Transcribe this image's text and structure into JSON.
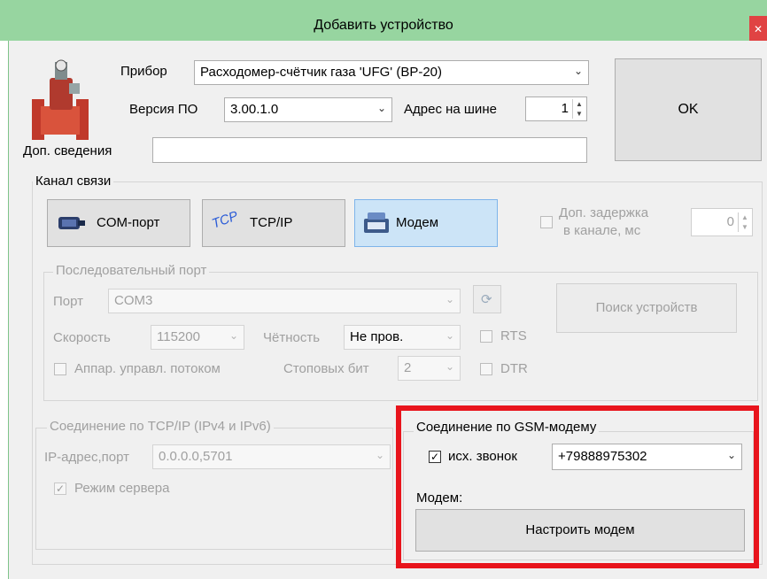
{
  "window": {
    "title": "Добавить устройство",
    "close_icon": "✕"
  },
  "device_row": {
    "label": "Прибор",
    "value": "Расходомер-счётчик газа 'UFG' (BP-20)"
  },
  "firmware_row": {
    "label": "Версия ПО",
    "value": "3.00.1.0",
    "bus_label": "Адрес на шине",
    "bus_value": "1"
  },
  "ok_button": "OK",
  "extra_info": {
    "label": "Доп. сведения",
    "value": ""
  },
  "channel": {
    "label": "Канал связи",
    "buttons": [
      {
        "label": "COM-порт",
        "icon": "serial-port-icon"
      },
      {
        "label": "TCP/IP",
        "icon": "tcp-icon",
        "icon_text": "TCP"
      },
      {
        "label": "Модем",
        "icon": "modem-icon"
      }
    ],
    "active": "Модем",
    "delay_label_1": "Доп. задержка",
    "delay_label_2": "в канале, мс",
    "delay_value": "0"
  },
  "serial": {
    "label": "Последовательный порт",
    "port_label": "Порт",
    "port_value": "COM3",
    "speed_label": "Скорость",
    "speed_value": "115200",
    "parity_label": "Чётность",
    "parity_value": "Не пров.",
    "rts_label": "RTS",
    "dtr_label": "DTR",
    "flow_label": "Аппар. управл. потоком",
    "stop_label": "Стоповых бит",
    "stop_value": "2",
    "search_button": "Поиск устройств"
  },
  "tcp": {
    "label": "Соединение по TCP/IP (IPv4 и IPv6)",
    "ip_label": "IP-адрес,порт",
    "ip_value": "0.0.0.0,5701",
    "server_label": "Режим сервера"
  },
  "gsm": {
    "label": "Соединение по GSM-модему",
    "call_label": "исх. звонок",
    "call_checked": true,
    "phone_value": "+79888975302",
    "modem_label": "Модем:",
    "config_button": "Настроить модем",
    "highlight_color": "#e8141c"
  },
  "colors": {
    "titlebar": "#97d5a0",
    "active_button": "#cce4f7"
  }
}
